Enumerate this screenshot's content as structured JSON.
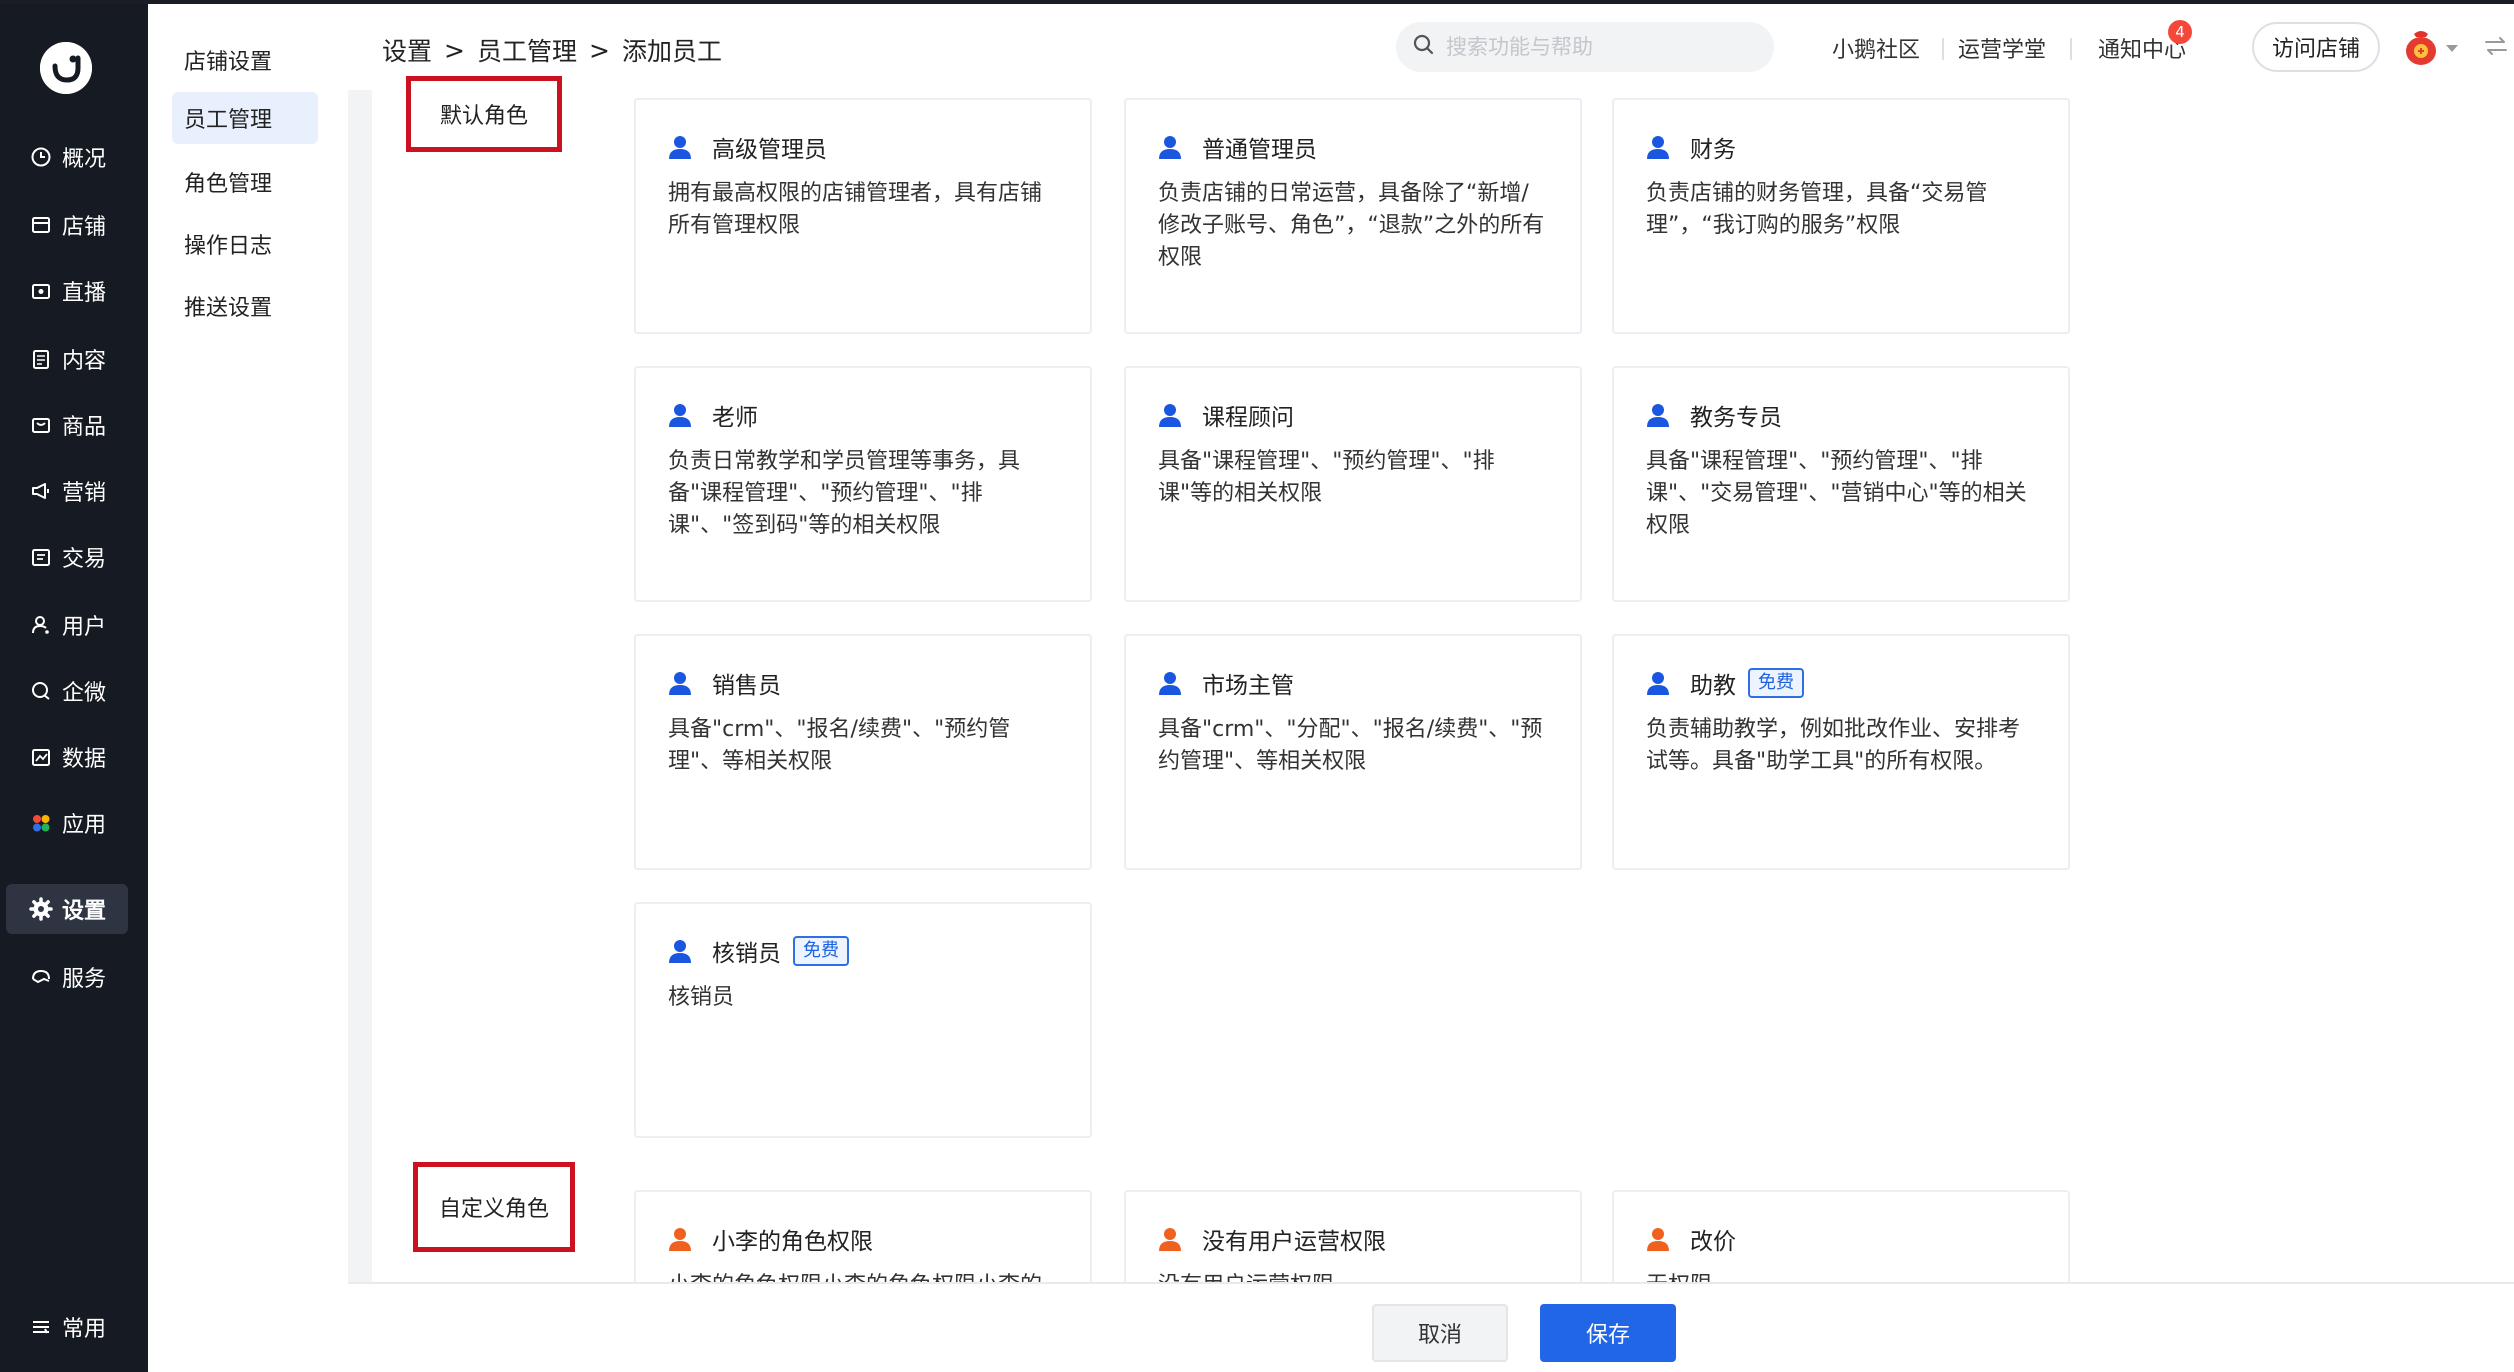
{
  "nav": {
    "items": [
      {
        "label": "概况",
        "icon": "clock-icon"
      },
      {
        "label": "店铺",
        "icon": "store-icon"
      },
      {
        "label": "直播",
        "icon": "live-icon"
      },
      {
        "label": "内容",
        "icon": "document-icon"
      },
      {
        "label": "商品",
        "icon": "box-icon"
      },
      {
        "label": "营销",
        "icon": "megaphone-icon"
      },
      {
        "label": "交易",
        "icon": "receipt-icon"
      },
      {
        "label": "用户",
        "icon": "user-icon"
      },
      {
        "label": "企微",
        "icon": "chat-icon"
      },
      {
        "label": "数据",
        "icon": "chart-icon"
      },
      {
        "label": "应用",
        "icon": "apps-icon"
      },
      {
        "label": "设置",
        "icon": "gear-icon"
      },
      {
        "label": "服务",
        "icon": "service-icon"
      }
    ],
    "bottom_label": "常用",
    "active": "设置"
  },
  "submenu": {
    "items": [
      "店铺设置",
      "员工管理",
      "角色管理",
      "操作日志",
      "推送设置"
    ],
    "active": "员工管理"
  },
  "breadcrumb": [
    "设置",
    "员工管理",
    "添加员工"
  ],
  "header": {
    "search_placeholder": "搜索功能与帮助",
    "links": [
      "小鹅社区",
      "运营学堂",
      "通知中心"
    ],
    "notification_count": "4",
    "visit_store": "访问店铺"
  },
  "sections": {
    "default_label": "默认角色",
    "custom_label": "自定义角色"
  },
  "default_roles": [
    {
      "title": "高级管理员",
      "desc": "拥有最高权限的店铺管理者，具有店铺所有管理权限",
      "tag": ""
    },
    {
      "title": "普通管理员",
      "desc": "负责店铺的日常运营，具备除了“新增/修改子账号、角色”，“退款”之外的所有权限",
      "tag": ""
    },
    {
      "title": "财务",
      "desc": "负责店铺的财务管理，具备“交易管理”，“我订购的服务”权限",
      "tag": ""
    },
    {
      "title": "老师",
      "desc": "负责日常教学和学员管理等事务，具备\"课程管理\"、\"预约管理\"、\"排课\"、\"签到码\"等的相关权限",
      "tag": ""
    },
    {
      "title": "课程顾问",
      "desc": "具备\"课程管理\"、\"预约管理\"、\"排课\"等的相关权限",
      "tag": ""
    },
    {
      "title": "教务专员",
      "desc": "具备\"课程管理\"、\"预约管理\"、\"排课\"、\"交易管理\"、\"营销中心\"等的相关权限",
      "tag": ""
    },
    {
      "title": "销售员",
      "desc": "具备\"crm\"、\"报名/续费\"、\"预约管理\"、等相关权限",
      "tag": ""
    },
    {
      "title": "市场主管",
      "desc": "具备\"crm\"、\"分配\"、\"报名/续费\"、\"预约管理\"、等相关权限",
      "tag": ""
    },
    {
      "title": "助教",
      "desc": "负责辅助教学，例如批改作业、安排考试等。具备\"助学工具\"的所有权限。",
      "tag": "免费"
    },
    {
      "title": "核销员",
      "desc": "核销员",
      "tag": "免费"
    }
  ],
  "custom_roles": [
    {
      "title": "小李的角色权限",
      "desc": "小李的角色权限小李的角色权限小李的"
    },
    {
      "title": "没有用户运营权限",
      "desc": "没有用户运营权限"
    },
    {
      "title": "改价",
      "desc": "无权限"
    }
  ],
  "footer": {
    "cancel": "取消",
    "save": "保存"
  },
  "colors": {
    "nav_bg": "#161a22",
    "primary": "#2266e8",
    "highlight_box": "#cc1120",
    "custom_icon": "#f0601f"
  }
}
